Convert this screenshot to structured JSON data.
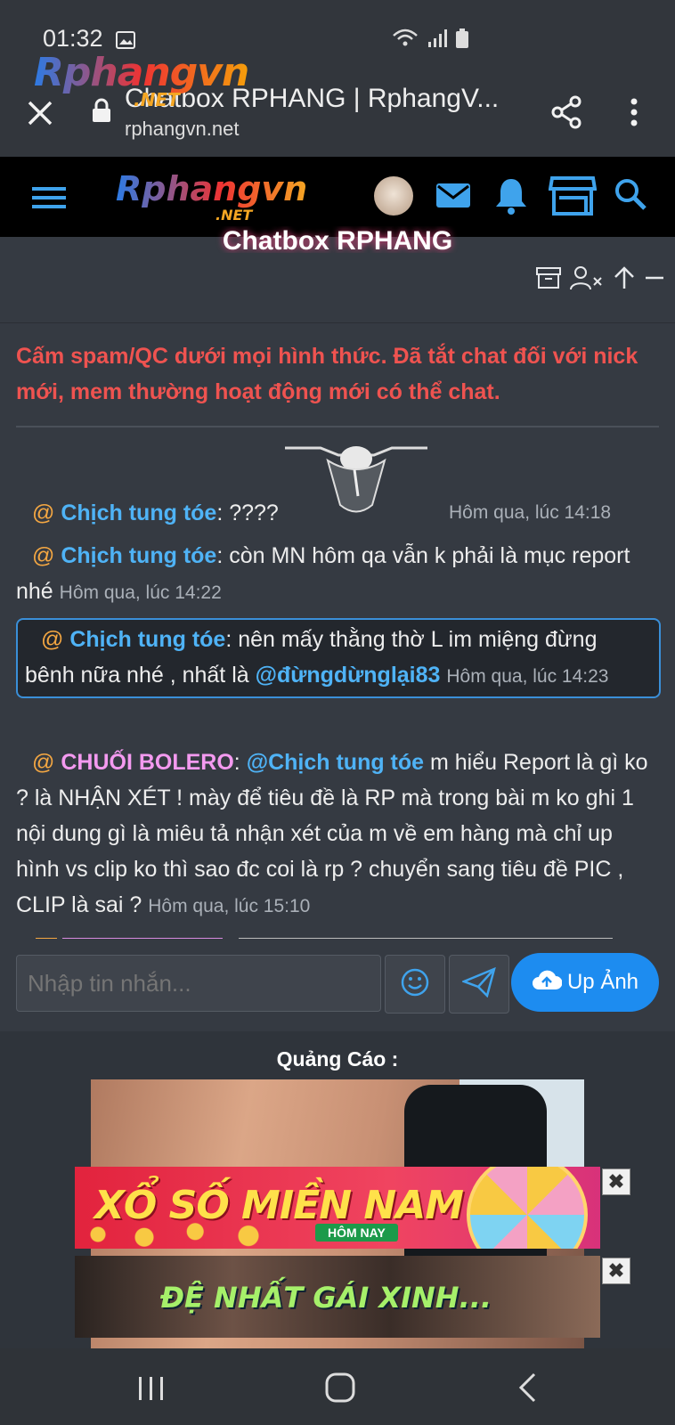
{
  "status_bar": {
    "time": "01:32"
  },
  "browser": {
    "title": "Chatbox RPHANG | RphangV...",
    "url": "rphangvn.net",
    "logo_overlay": "Rphangvn",
    "logo_overlay_suffix": ".NET"
  },
  "site_header": {
    "logo": "Rphangvn",
    "logo_suffix": ".NET"
  },
  "chatbox": {
    "title": "Chatbox RPHANG",
    "notice": "Cấm spam/QC dưới mọi hình thức. Đã tắt chat đối với nick mới, mem thường hoạt động mới có thể chat.",
    "messages": [
      {
        "at": "@",
        "user": "Chịch tung tóe",
        "text": ": ????",
        "time": "Hôm qua, lúc 14:18"
      },
      {
        "at": "@",
        "user": "Chịch tung tóe",
        "text": ": còn MN hôm qa vẫn k phải là mục report nhé",
        "time": "Hôm qua, lúc 14:22"
      },
      {
        "at": "@",
        "user": "Chịch tung tóe",
        "text": ": nên mấy thằng thờ L im miệng đừng bênh nữa nhé , nhất là ",
        "mention": "@đừngdừnglại83",
        "time": "Hôm qua, lúc 14:23"
      },
      {
        "at": "@",
        "user": "CHUỐI BOLERO",
        "text_pre": ": ",
        "mention": "@Chịch tung tóe",
        "text": " m hiểu Report là gì ko ? là NHẬN XÉT ! mày để tiêu đề là RP mà trong bài m ko ghi 1 nội dung gì là miêu tả nhận xét của m về em hàng mà chỉ up hình vs clip ko thì sao đc coi là rp ? chuyển sang tiêu đề PIC , CLIP là sai ?",
        "time": "Hôm qua, lúc 15:10"
      }
    ],
    "input_placeholder": "Nhập tin nhắn...",
    "upload_label": "Up Ảnh"
  },
  "ads": {
    "label": "Quảng Cáo :",
    "banner1_text": "XỔ SỐ MIỀN NAM",
    "banner1_tag": "HÔM NAY",
    "banner2_text": "ĐỆ NHẤT GÁI XINH...",
    "close_glyph": "✖"
  },
  "colors": {
    "accent": "#1d8cf0",
    "link": "#4fb3f6",
    "notice": "#ef5350",
    "mention_at": "#f4a742"
  }
}
